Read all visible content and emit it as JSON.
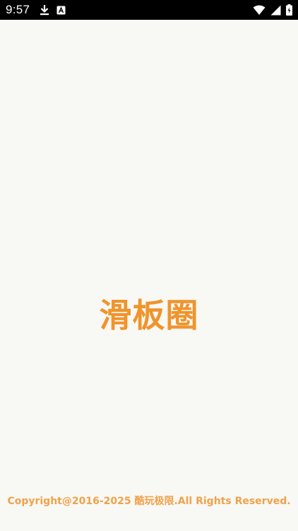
{
  "status_bar": {
    "time": "9:57",
    "icons": [
      "download-icon",
      "a-notification-icon",
      "wifi-icon",
      "cell-signal-icon",
      "battery-charging-icon"
    ]
  },
  "splash": {
    "title": "滑板圈",
    "copyright": "Copyright@2016-2025 酷玩极限.All Rights Reserved."
  },
  "colors": {
    "accent": "#f0942c",
    "background": "#f8f8f4",
    "status_bar": "#000000"
  }
}
